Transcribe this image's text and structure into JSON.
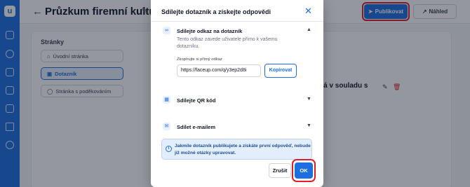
{
  "header": {
    "back_icon": "arrow-left-icon",
    "title": "Průzkum firemní kultury",
    "edit_icon": "pencil-icon",
    "publish_label": "Publikovat",
    "preview_label": "Náhled"
  },
  "sidebar_rail": {
    "logo": "u",
    "icons": [
      "home-icon",
      "chart-icon",
      "inbox-icon",
      "clipboard-icon",
      "folder-icon",
      "shuffle-icon",
      "user-icon"
    ]
  },
  "pages": {
    "heading": "Stránky",
    "items": [
      {
        "label": "Úvodní stránka",
        "icon": "home-icon",
        "active": false
      },
      {
        "label": "Dotazník",
        "icon": "document-icon",
        "active": true
      },
      {
        "label": "Stránka s poděkováním",
        "icon": "check-circle-icon",
        "active": false
      }
    ]
  },
  "background_text": "ná v souladu s",
  "modal": {
    "title": "Sdílejte dotazník a získejte odpovědi",
    "close_icon": "close-icon",
    "sections": [
      {
        "label": "Sdílejte odkaz na dotazník",
        "icon": "link-icon",
        "expanded": true
      },
      {
        "label": "Sdílejte QR kód",
        "icon": "qr-code-icon",
        "expanded": false
      },
      {
        "label": "Sdílet e-mailem",
        "icon": "mail-icon",
        "expanded": false
      }
    ],
    "link_description": "Tento odkaz zavede uživatele přímo k vašemu dotazníku.",
    "link_hint": "Zkopírujte si přímý odkaz",
    "link_value": "https://faceup.com/q/y3ep2d8i",
    "copy_label": "Kopírovat",
    "info_text": "Jakmile dotazník publikujete a získáte první odpověď, nebude již možné otázky upravovat.",
    "cancel_label": "Zrušit",
    "ok_label": "OK"
  },
  "colors": {
    "primary": "#1d6fe0",
    "highlight": "#e11d26",
    "info_bg": "#e3eefc"
  }
}
